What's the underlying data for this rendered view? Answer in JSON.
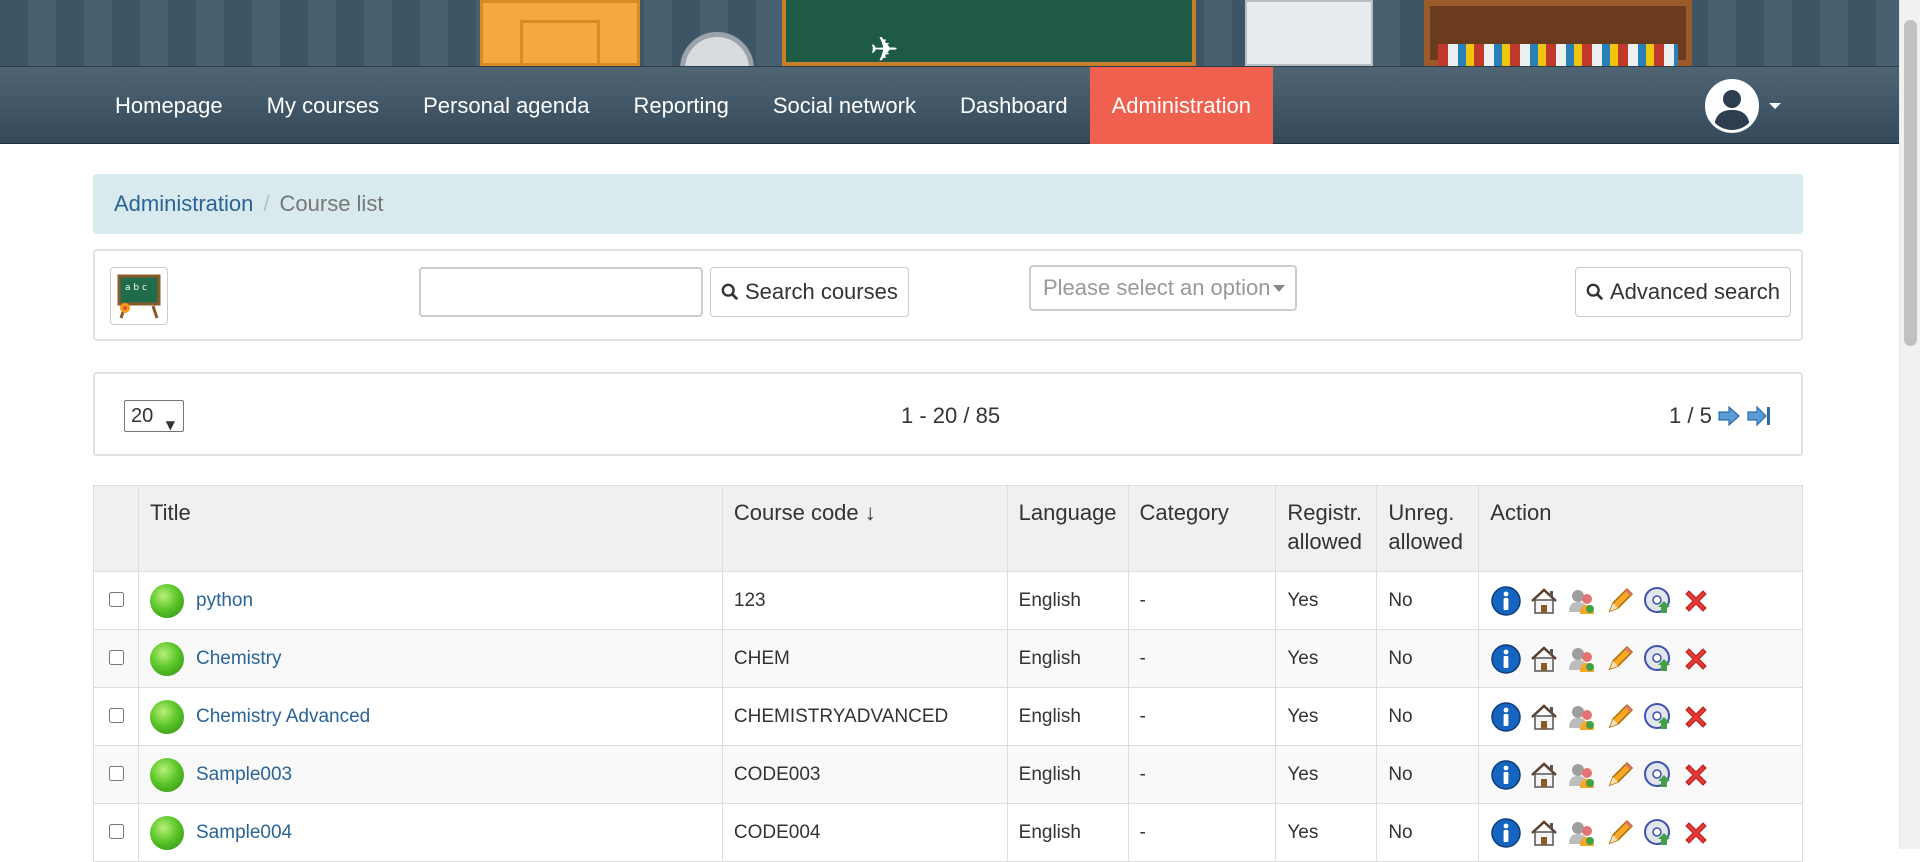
{
  "nav": {
    "items": [
      {
        "label": "Homepage",
        "active": false
      },
      {
        "label": "My courses",
        "active": false
      },
      {
        "label": "Personal agenda",
        "active": false
      },
      {
        "label": "Reporting",
        "active": false
      },
      {
        "label": "Social network",
        "active": false
      },
      {
        "label": "Dashboard",
        "active": false
      },
      {
        "label": "Administration",
        "active": true
      }
    ],
    "active_color": "#f0604f"
  },
  "breadcrumb": {
    "root": "Administration",
    "current": "Course list"
  },
  "toolbar": {
    "search_value": "",
    "search_button": "Search courses",
    "category_placeholder": "Please select an option",
    "advanced_button": "Advanced search"
  },
  "pager": {
    "page_size": "20",
    "range": "1 - 20 / 85",
    "pages": "1 / 5"
  },
  "table": {
    "headers": [
      "Title",
      "Course code ↓",
      "Language",
      "Category",
      "Registr. allowed",
      "Unreg. allowed",
      "Action"
    ],
    "rows": [
      {
        "title": "python",
        "code": "123",
        "language": "English",
        "category": "-",
        "registr": "Yes",
        "unreg": "No"
      },
      {
        "title": "Chemistry",
        "code": "CHEM",
        "language": "English",
        "category": "-",
        "registr": "Yes",
        "unreg": "No"
      },
      {
        "title": "Chemistry Advanced",
        "code": "CHEMISTRYADVANCED",
        "language": "English",
        "category": "-",
        "registr": "Yes",
        "unreg": "No"
      },
      {
        "title": "Sample003",
        "code": "CODE003",
        "language": "English",
        "category": "-",
        "registr": "Yes",
        "unreg": "No"
      },
      {
        "title": "Sample004",
        "code": "CODE004",
        "language": "English",
        "category": "-",
        "registr": "Yes",
        "unreg": "No"
      }
    ],
    "action_icons": [
      "info-icon",
      "home-icon",
      "users-icon",
      "edit-pencil-icon",
      "backup-disc-icon",
      "delete-icon"
    ]
  },
  "colors": {
    "link": "#2a6496",
    "breadcrumb_bg": "#d9eaee",
    "navbar": "#3d5363"
  }
}
